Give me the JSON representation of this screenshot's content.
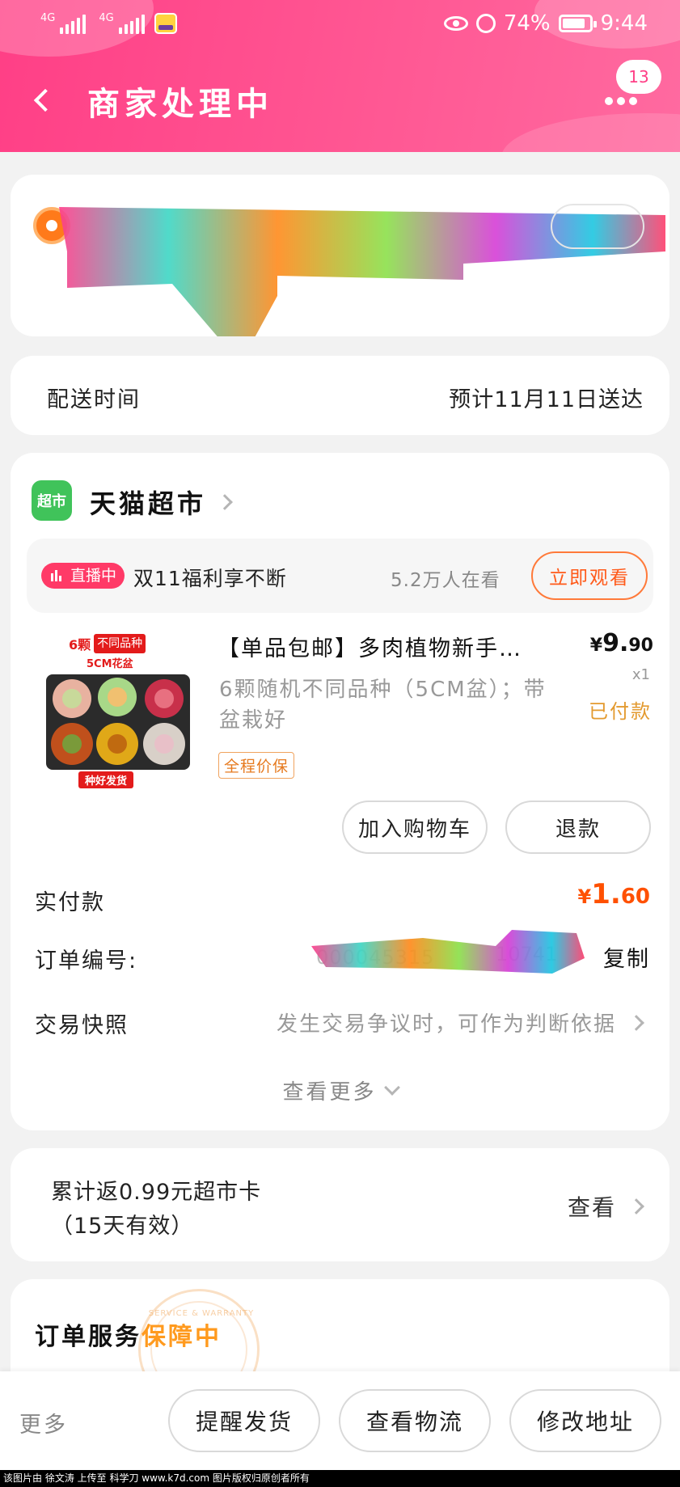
{
  "status_bar": {
    "net1": "4G",
    "net2": "4G",
    "battery": "74%",
    "time": "9:44"
  },
  "header": {
    "title": "商家处理中",
    "badge_count": "13"
  },
  "delivery": {
    "label": "配送时间",
    "value": "预计11月11日送达"
  },
  "store": {
    "icon_text": "超市",
    "name": "天猫超市"
  },
  "live": {
    "badge": "直播中",
    "text": "双11福利享不断",
    "viewers": "5.2万人在看",
    "watch_button": "立即观看"
  },
  "product": {
    "image_text_count": "6颗",
    "image_text_variety": "不同品种",
    "image_text_pot": "5CM花盆",
    "image_text_footer": "种好发货",
    "title": "【单品包邮】多肉植物新手…",
    "spec": "6颗随机不同品种（5CM盆）；带盆栽好",
    "tag": "全程价保",
    "price_symbol": "¥",
    "price_int": "9.",
    "price_dec": "90",
    "quantity": "x1",
    "pay_status": "已付款"
  },
  "actions": {
    "add_cart": "加入购物车",
    "refund": "退款"
  },
  "order": {
    "paid_label": "实付款",
    "paid_symbol": "¥",
    "paid_int": "1.",
    "paid_dec": "60",
    "number_label": "订单编号:",
    "number_visible": "000045315",
    "number_tail": "10741",
    "copy": "复制",
    "snapshot_label": "交易快照",
    "snapshot_value": "发生交易争议时，可作为判断依据",
    "more": "查看更多"
  },
  "rebate": {
    "line1": "累计返0.99元超市卡",
    "line2": "（15天有效）",
    "view": "查看"
  },
  "service": {
    "title": "订单服务",
    "highlight": "保障中",
    "seal_text": "SERVICE & WARRANTY"
  },
  "bottom_bar": {
    "more": "更多",
    "remind": "提醒发货",
    "logistics": "查看物流",
    "address": "修改地址"
  },
  "watermark": "该图片由 徐文涛 上传至 科学刀 www.k7d.com 图片版权归原创者所有",
  "colors": {
    "header_pink": "#ff4d8d",
    "price_orange": "#ff5000",
    "pay_gold": "#e39a2f",
    "tmall_green": "#40c35a"
  }
}
